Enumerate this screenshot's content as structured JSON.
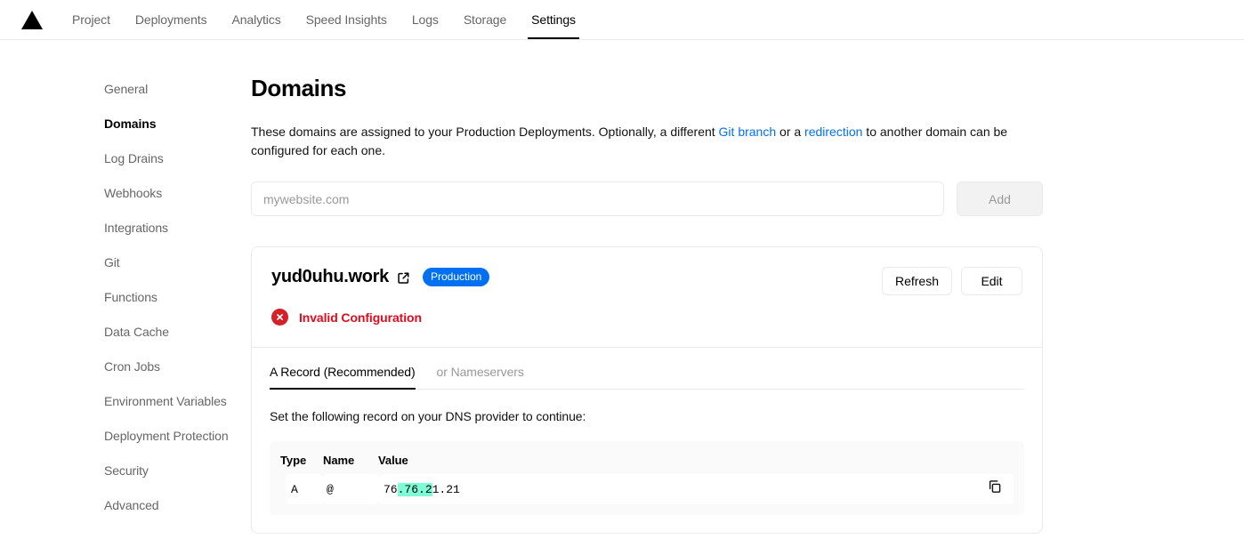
{
  "topnav": {
    "logo": "vercel-triangle-logo",
    "items": [
      {
        "label": "Project",
        "active": false
      },
      {
        "label": "Deployments",
        "active": false
      },
      {
        "label": "Analytics",
        "active": false
      },
      {
        "label": "Speed Insights",
        "active": false
      },
      {
        "label": "Logs",
        "active": false
      },
      {
        "label": "Storage",
        "active": false
      },
      {
        "label": "Settings",
        "active": true
      }
    ]
  },
  "sidebar": {
    "items": [
      {
        "label": "General",
        "active": false
      },
      {
        "label": "Domains",
        "active": true
      },
      {
        "label": "Log Drains",
        "active": false
      },
      {
        "label": "Webhooks",
        "active": false
      },
      {
        "label": "Integrations",
        "active": false
      },
      {
        "label": "Git",
        "active": false
      },
      {
        "label": "Functions",
        "active": false
      },
      {
        "label": "Data Cache",
        "active": false
      },
      {
        "label": "Cron Jobs",
        "active": false
      },
      {
        "label": "Environment Variables",
        "active": false
      },
      {
        "label": "Deployment Protection",
        "active": false
      },
      {
        "label": "Security",
        "active": false
      },
      {
        "label": "Advanced",
        "active": false
      }
    ]
  },
  "main": {
    "title": "Domains",
    "description": {
      "part1": "These domains are assigned to your Production Deployments. Optionally, a different ",
      "link1": "Git branch",
      "part2": " or a ",
      "link2": "redirection",
      "part3": " to another domain can be configured for each one."
    },
    "add_form": {
      "placeholder": "mywebsite.com",
      "value": "",
      "add_label": "Add"
    }
  },
  "domain_card": {
    "name": "yud0uhu.work",
    "external_link_icon": "external-link-icon",
    "badge": "Production",
    "status": {
      "icon": "error-circle-x-icon",
      "text": "Invalid Configuration"
    },
    "actions": {
      "refresh_label": "Refresh",
      "edit_label": "Edit"
    },
    "tabs": [
      {
        "label": "A Record (Recommended)",
        "active": true
      },
      {
        "label": "or Nameservers",
        "active": false
      }
    ],
    "dns_note": "Set the following record on your DNS provider to continue:",
    "dns_table": {
      "columns": [
        "Type",
        "Name",
        "Value"
      ],
      "row": {
        "type": "A",
        "name": "@",
        "value_prefix": "76",
        "value_selected": ".76.2",
        "value_suffix": "1.21"
      },
      "copy_icon": "copy-icon"
    }
  },
  "colors": {
    "accent_blue": "#0070f3",
    "error_red": "#e00b1c",
    "error_icon_red": "#d32029",
    "selection_highlight": "#7efcd7",
    "border": "#eaeaea",
    "muted_text": "#666666",
    "table_bg": "#fafafa"
  }
}
